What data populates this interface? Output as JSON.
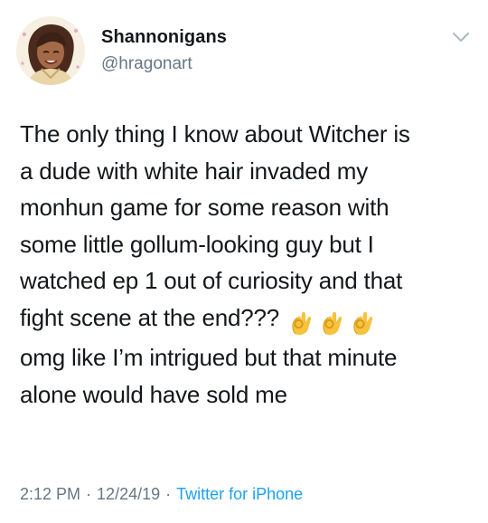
{
  "user": {
    "display_name": "Shannonigans",
    "handle": "@hragonart",
    "avatar_icon": "illustrated-portrait-avatar"
  },
  "tweet": {
    "lines": [
      "The only thing I know about Witcher is",
      "a dude with white hair invaded my",
      "monhun game for some reason with",
      "some little gollum-looking guy but I",
      "watched ep 1 out of curiosity and that",
      "fight scene at the end???",
      "omg like I’m intrigued but that minute",
      "alone would have sold me"
    ],
    "emoji_icon": "ok-hand-emoji",
    "emoji_count": 3
  },
  "meta": {
    "time": "2:12 PM",
    "separator": "·",
    "date": "12/24/19",
    "source": "Twitter for iPhone"
  },
  "colors": {
    "text": "#14171a",
    "secondary": "#657786",
    "link": "#1da1f2",
    "chevron": "#aab8c2"
  }
}
